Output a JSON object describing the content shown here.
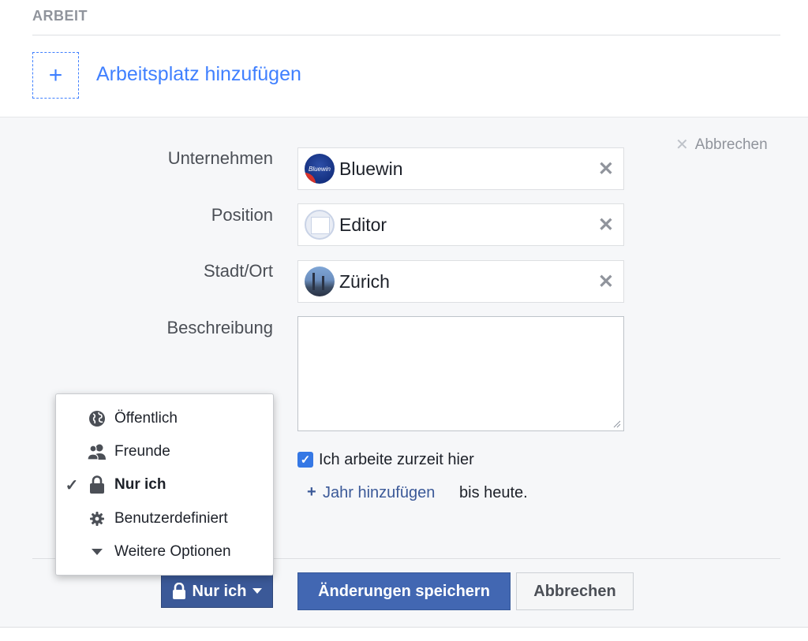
{
  "header": {
    "section_title": "ARBEIT",
    "add_workplace": "Arbeitsplatz hinzufügen",
    "add_symbol": "+"
  },
  "form": {
    "cancel_top": "Abbrechen",
    "fields": {
      "company": {
        "label": "Unternehmen",
        "value": "Bluewin",
        "thumb_text": "Bluewin"
      },
      "position": {
        "label": "Position",
        "value": "Editor"
      },
      "city": {
        "label": "Stadt/Ort",
        "value": "Zürich"
      },
      "description": {
        "label": "Beschreibung",
        "value": ""
      }
    },
    "currently_working": {
      "label": "Ich arbeite zurzeit hier",
      "checked": true
    },
    "add_year": "Jahr hinzufügen",
    "until_today": "bis heute."
  },
  "privacy_menu": {
    "items": [
      {
        "label": "Öffentlich",
        "icon": "globe-icon",
        "selected": false
      },
      {
        "label": "Freunde",
        "icon": "friends-icon",
        "selected": false
      },
      {
        "label": "Nur ich",
        "icon": "lock-icon",
        "selected": true
      },
      {
        "label": "Benutzerdefiniert",
        "icon": "gear-icon",
        "selected": false
      },
      {
        "label": "Weitere Optionen",
        "icon": "caret-down-icon",
        "selected": false
      }
    ]
  },
  "buttons": {
    "privacy": "Nur ich",
    "save": "Änderungen speichern",
    "cancel": "Abbrechen"
  },
  "colors": {
    "link_blue": "#4080ff",
    "primary_button": "#4267b2",
    "privacy_button": "#3b5998",
    "checkbox": "#3578e5"
  }
}
